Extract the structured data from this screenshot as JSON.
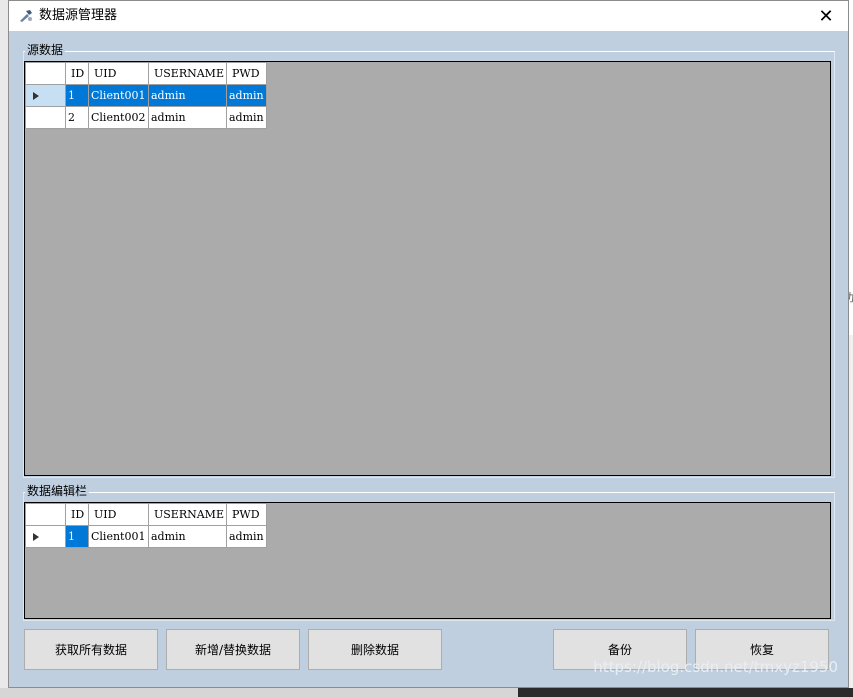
{
  "window": {
    "title": "数据源管理器",
    "close_glyph": "✕"
  },
  "source_group": {
    "label": "源数据",
    "columns": [
      "ID",
      "UID",
      "USERNAME",
      "PWD"
    ],
    "rows": [
      {
        "id": "1",
        "uid": "Client001",
        "username": "admin",
        "pwd": "admin"
      },
      {
        "id": "2",
        "uid": "Client002",
        "username": "admin",
        "pwd": "admin"
      }
    ]
  },
  "edit_group": {
    "label": "数据编辑栏",
    "columns": [
      "ID",
      "UID",
      "USERNAME",
      "PWD"
    ],
    "rows": [
      {
        "id": "1",
        "uid": "Client001",
        "username": "admin",
        "pwd": "admin"
      }
    ]
  },
  "buttons": {
    "get_all": "获取所有数据",
    "add_replace": "新增/替换数据",
    "delete": "删除数据",
    "backup": "备份",
    "restore": "恢复"
  },
  "watermark": "https://blog.csdn.net/tmxyz1950",
  "background_peek": "功",
  "colors": {
    "window_bg": "#bfcfdf",
    "grid_bg": "#ababab",
    "selection": "#0078d7",
    "current_row_header": "#c7dff2"
  }
}
